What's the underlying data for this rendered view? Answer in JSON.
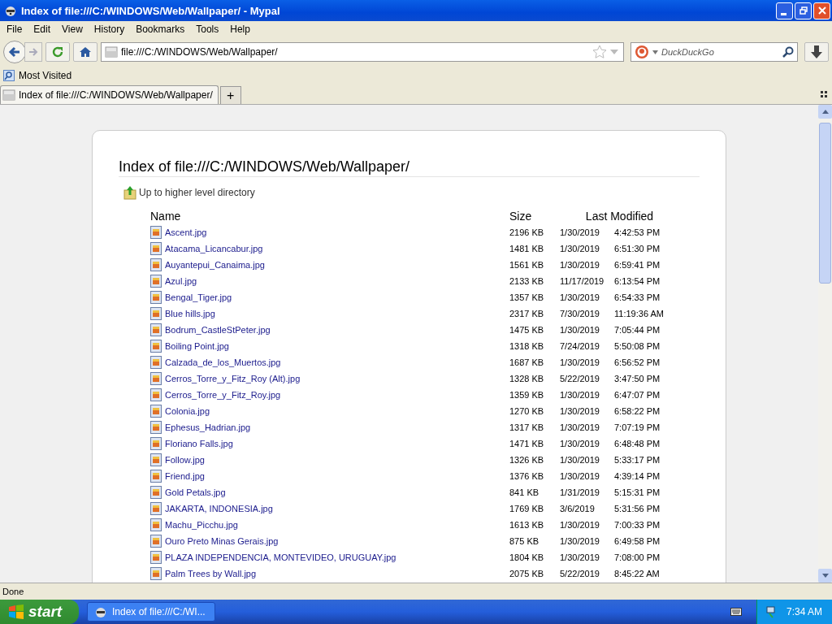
{
  "window": {
    "title": "Index of file:///C:/WINDOWS/Web/Wallpaper/ - Mypal"
  },
  "menu": [
    "File",
    "Edit",
    "View",
    "History",
    "Bookmarks",
    "Tools",
    "Help"
  ],
  "address": {
    "value": "file:///C:/WINDOWS/Web/Wallpaper/"
  },
  "search": {
    "placeholder": "DuckDuckGo"
  },
  "bookmarks": [
    "Most Visited"
  ],
  "tabs": [
    {
      "label": "Index of file:///C:/WINDOWS/Web/Wallpaper/",
      "selected": true
    }
  ],
  "new_tab": "+",
  "page": {
    "heading": "Index of file:///C:/WINDOWS/Web/Wallpaper/",
    "up_link": "Up to higher level directory",
    "columns": [
      "Name",
      "Size",
      "Last Modified"
    ],
    "rows": [
      {
        "name": "Ascent.jpg",
        "size": "2196 KB",
        "date": "1/30/2019",
        "time": "4:42:53 PM"
      },
      {
        "name": "Atacama_Licancabur.jpg",
        "size": "1481 KB",
        "date": "1/30/2019",
        "time": "6:51:30 PM"
      },
      {
        "name": "Auyantepui_Canaima.jpg",
        "size": "1561 KB",
        "date": "1/30/2019",
        "time": "6:59:41 PM"
      },
      {
        "name": "Azul.jpg",
        "size": "2133 KB",
        "date": "11/17/2019",
        "time": "6:13:54 PM"
      },
      {
        "name": "Bengal_Tiger.jpg",
        "size": "1357 KB",
        "date": "1/30/2019",
        "time": "6:54:33 PM"
      },
      {
        "name": "Blue hills.jpg",
        "size": "2317 KB",
        "date": "7/30/2019",
        "time": "11:19:36 AM"
      },
      {
        "name": "Bodrum_CastleStPeter.jpg",
        "size": "1475 KB",
        "date": "1/30/2019",
        "time": "7:05:44 PM"
      },
      {
        "name": "Boiling Point.jpg",
        "size": "1318 KB",
        "date": "7/24/2019",
        "time": "5:50:08 PM"
      },
      {
        "name": "Calzada_de_los_Muertos.jpg",
        "size": "1687 KB",
        "date": "1/30/2019",
        "time": "6:56:52 PM"
      },
      {
        "name": "Cerros_Torre_y_Fitz_Roy (Alt).jpg",
        "size": "1328 KB",
        "date": "5/22/2019",
        "time": "3:47:50 PM"
      },
      {
        "name": "Cerros_Torre_y_Fitz_Roy.jpg",
        "size": "1359 KB",
        "date": "1/30/2019",
        "time": "6:47:07 PM"
      },
      {
        "name": "Colonia.jpg",
        "size": "1270 KB",
        "date": "1/30/2019",
        "time": "6:58:22 PM"
      },
      {
        "name": "Ephesus_Hadrian.jpg",
        "size": "1317 KB",
        "date": "1/30/2019",
        "time": "7:07:19 PM"
      },
      {
        "name": "Floriano Falls.jpg",
        "size": "1471 KB",
        "date": "1/30/2019",
        "time": "6:48:48 PM"
      },
      {
        "name": "Follow.jpg",
        "size": "1326 KB",
        "date": "1/30/2019",
        "time": "5:33:17 PM"
      },
      {
        "name": "Friend.jpg",
        "size": "1376 KB",
        "date": "1/30/2019",
        "time": "4:39:14 PM"
      },
      {
        "name": "Gold Petals.jpg",
        "size": "841 KB",
        "date": "1/31/2019",
        "time": "5:15:31 PM"
      },
      {
        "name": "JAKARTA, INDONESIA.jpg",
        "size": "1769 KB",
        "date": "3/6/2019",
        "time": "5:31:56 PM"
      },
      {
        "name": "Machu_Picchu.jpg",
        "size": "1613 KB",
        "date": "1/30/2019",
        "time": "7:00:33 PM"
      },
      {
        "name": "Ouro Preto Minas Gerais.jpg",
        "size": "875 KB",
        "date": "1/30/2019",
        "time": "6:49:58 PM"
      },
      {
        "name": "PLAZA INDEPENDENCIA, MONTEVIDEO, URUGUAY.jpg",
        "size": "1804 KB",
        "date": "1/30/2019",
        "time": "7:08:00 PM"
      },
      {
        "name": "Palm Trees by Wall.jpg",
        "size": "2075 KB",
        "date": "5/22/2019",
        "time": "8:45:22 AM"
      }
    ]
  },
  "status_bar": "Done",
  "taskbar": {
    "start": "start",
    "task": "Index of file:///C:/WI...",
    "clock": "7:34 AM"
  }
}
